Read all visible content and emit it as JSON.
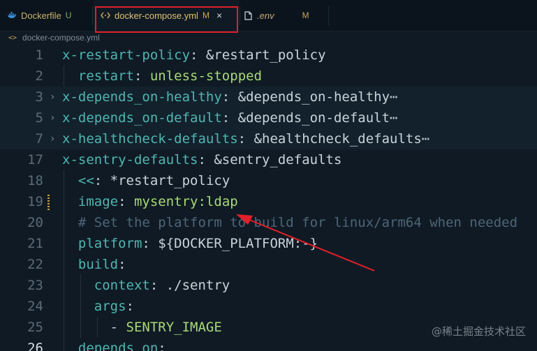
{
  "tabs": {
    "dockerfile": {
      "label": "Dockerfile",
      "badge": "U"
    },
    "compose": {
      "label": "docker-compose.yml",
      "badge": "M",
      "close": "×"
    },
    "env": {
      "label": ".env",
      "badge": "M"
    }
  },
  "breadcrumb": {
    "icon": "<>",
    "file": "docker-compose.yml"
  },
  "editor": {
    "lines": [
      {
        "num": "1",
        "indent": "",
        "key": "x-restart-policy",
        "colon": ": ",
        "value": "&restart_policy",
        "value_class": "p"
      },
      {
        "num": "2",
        "indent": "  ",
        "key": "restart",
        "colon": ": ",
        "value": "unless-stopped",
        "value_class": "v"
      },
      {
        "num": "3",
        "indent": "",
        "key": "x-depends_on-healthy",
        "colon": ": ",
        "value": "&depends_on-healthy",
        "value_class": "p",
        "ellipsis": "⋯"
      },
      {
        "num": "5",
        "indent": "",
        "key": "x-depends_on-default",
        "colon": ": ",
        "value": "&depends_on-default",
        "value_class": "p",
        "ellipsis": "⋯"
      },
      {
        "num": "7",
        "indent": "",
        "key": "x-healthcheck-defaults",
        "colon": ": ",
        "value": "&healthcheck_defaults",
        "value_class": "p",
        "ellipsis": "⋯"
      },
      {
        "num": "17",
        "indent": "",
        "key": "x-sentry-defaults",
        "colon": ": ",
        "value": "&sentry_defaults",
        "value_class": "p"
      },
      {
        "num": "18",
        "indent": "  ",
        "key": "<<",
        "colon": ": ",
        "value": "*restart_policy",
        "value_class": "p"
      },
      {
        "num": "19",
        "indent": "  ",
        "key": "image",
        "colon": ": ",
        "value": "mysentry:ldap",
        "value_class": "v"
      },
      {
        "num": "20",
        "indent": "  ",
        "comment": "# Set the platform to build for linux/arm64 when needed"
      },
      {
        "num": "21",
        "indent": "  ",
        "key": "platform",
        "colon": ": ",
        "value": "${DOCKER_PLATFORM:-}",
        "value_class": "p"
      },
      {
        "num": "22",
        "indent": "  ",
        "key": "build",
        "colon": ":",
        "value": "",
        "value_class": "p"
      },
      {
        "num": "23",
        "indent": "    ",
        "key": "context",
        "colon": ": ",
        "value": "./sentry",
        "value_class": "p"
      },
      {
        "num": "24",
        "indent": "    ",
        "key": "args",
        "colon": ":",
        "value": "",
        "value_class": "p"
      },
      {
        "num": "25",
        "indent": "      ",
        "dash": "- ",
        "key": "SENTRY_IMAGE",
        "colon": "",
        "value": "",
        "value_class": "v"
      },
      {
        "num": "26",
        "indent": "  ",
        "key": "depends_on",
        "colon": ":",
        "value": "",
        "value_class": "p"
      }
    ]
  },
  "watermark": "@稀土掘金技术社区",
  "colors": {
    "background": "#0f1a24",
    "key": "#4fb7b0",
    "string": "#a9d977",
    "highlight_box": "#e0202a",
    "arrow": "#e0202a"
  }
}
